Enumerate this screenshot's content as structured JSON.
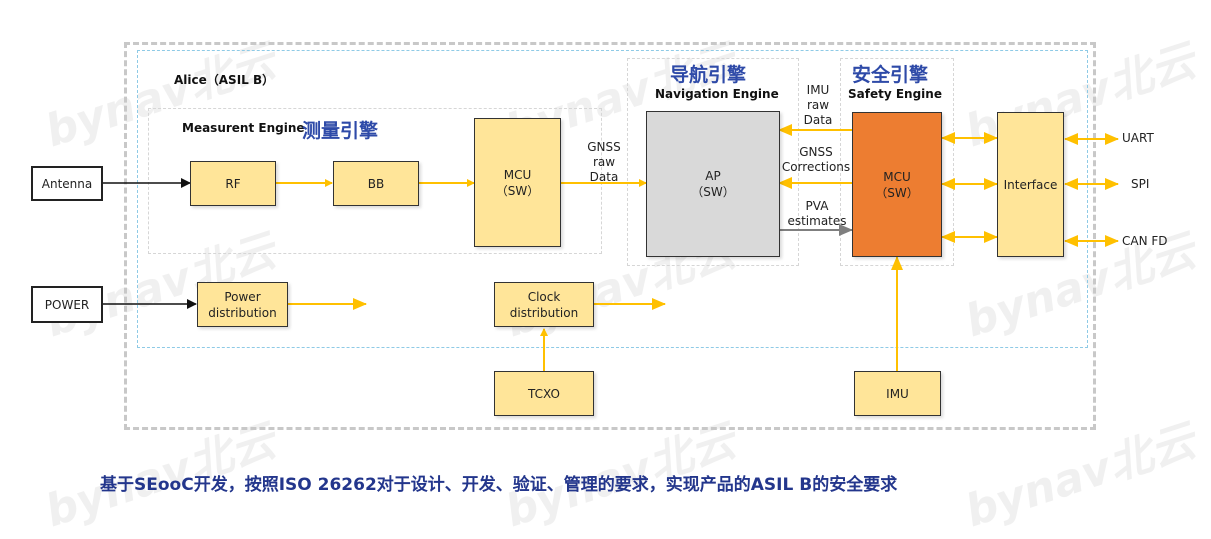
{
  "watermark": "bynav北云",
  "system": {
    "title": "Alice（ASIL B）"
  },
  "measurement_engine": {
    "title_en": "Measurent Engine",
    "title_cn": "测量引擎",
    "blocks": {
      "rf": "RF",
      "bb": "BB",
      "mcu": "MCU\n（SW）"
    }
  },
  "navigation_engine": {
    "title_cn": "导航引擎",
    "title_en": "Navigation Engine",
    "ap": "AP\n（SW）"
  },
  "safety_engine": {
    "title_cn": "安全引擎",
    "title_en": "Safety Engine",
    "mcu": "MCU\n（SW）"
  },
  "external": {
    "antenna": "Antenna",
    "power": "POWER",
    "tcxo": "TCXO",
    "imu": "IMU"
  },
  "distribution": {
    "power": "Power\ndistribution",
    "clock": "Clock\ndistribution"
  },
  "interface": {
    "label": "Interface",
    "ports": [
      "UART",
      "SPI",
      "CAN FD"
    ]
  },
  "signals": {
    "gnss_raw": "GNSS\nraw\nData",
    "imu_raw": "IMU\nraw\nData",
    "gnss_corrections": "GNSS\nCorrections",
    "pva": "PVA\nestimates"
  },
  "colors": {
    "block_fill": "#ffe599",
    "ap_fill": "#d9d9d9",
    "safety_mcu_fill": "#ed7d31",
    "arrow_yellow": "#ffc000",
    "arrow_grey": "#7f7f7f",
    "title_blue": "#2e4aa8"
  },
  "footer": "基于SEooC开发，按照ISO 26262对于设计、开发、验证、管理的要求，实现产品的ASIL B的安全要求"
}
